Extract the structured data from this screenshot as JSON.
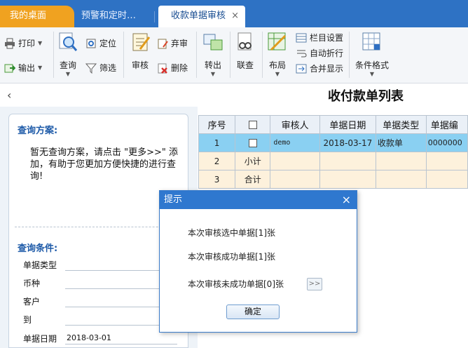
{
  "tabs": [
    {
      "label": "我的桌面"
    },
    {
      "label": "预警和定时…"
    },
    {
      "label": "收款单据审核",
      "close": "×"
    }
  ],
  "toolbar": {
    "print": "打印",
    "export": "输出",
    "query": "查询",
    "locate": "定位",
    "filter": "筛选",
    "audit": "审核",
    "abandon": "弃审",
    "delete": "删除",
    "transfer": "转出",
    "link": "联查",
    "layout": "布局",
    "column_settings": "栏目设置",
    "auto_wrap": "自动折行",
    "merge_display": "合并显示",
    "conditional_format": "条件格式"
  },
  "page": {
    "back": "‹",
    "title": "收付款单列表"
  },
  "left": {
    "scheme_title": "查询方案:",
    "scheme_hint": "暂无查询方案，请点击 \"更多>>\" 添加，有助于您更加方便快捷的进行查询!",
    "cond_title": "查询条件:",
    "fields": [
      {
        "label": "单据类型",
        "value": ""
      },
      {
        "label": "币种",
        "value": ""
      },
      {
        "label": "客户",
        "value": ""
      },
      {
        "label": "到",
        "value": ""
      },
      {
        "label": "单据日期",
        "value": "2018-03-01"
      }
    ]
  },
  "grid": {
    "headers": [
      "序号",
      "",
      "审核人",
      "单据日期",
      "单据类型",
      "单据编"
    ],
    "rows": [
      [
        "1",
        "",
        "demo",
        "2018-03-17",
        "收款单",
        "0000000"
      ],
      [
        "2",
        "小计",
        "",
        "",
        "",
        ""
      ],
      [
        "3",
        "合计",
        "",
        "",
        "",
        ""
      ]
    ]
  },
  "dialog": {
    "title": "提示",
    "close": "×",
    "msg1": "本次审核选中单据[1]张",
    "msg2": "本次审核成功单据[1]张",
    "msg3": "本次审核未成功单据[0]张",
    "more": ">>",
    "ok": "确定"
  }
}
